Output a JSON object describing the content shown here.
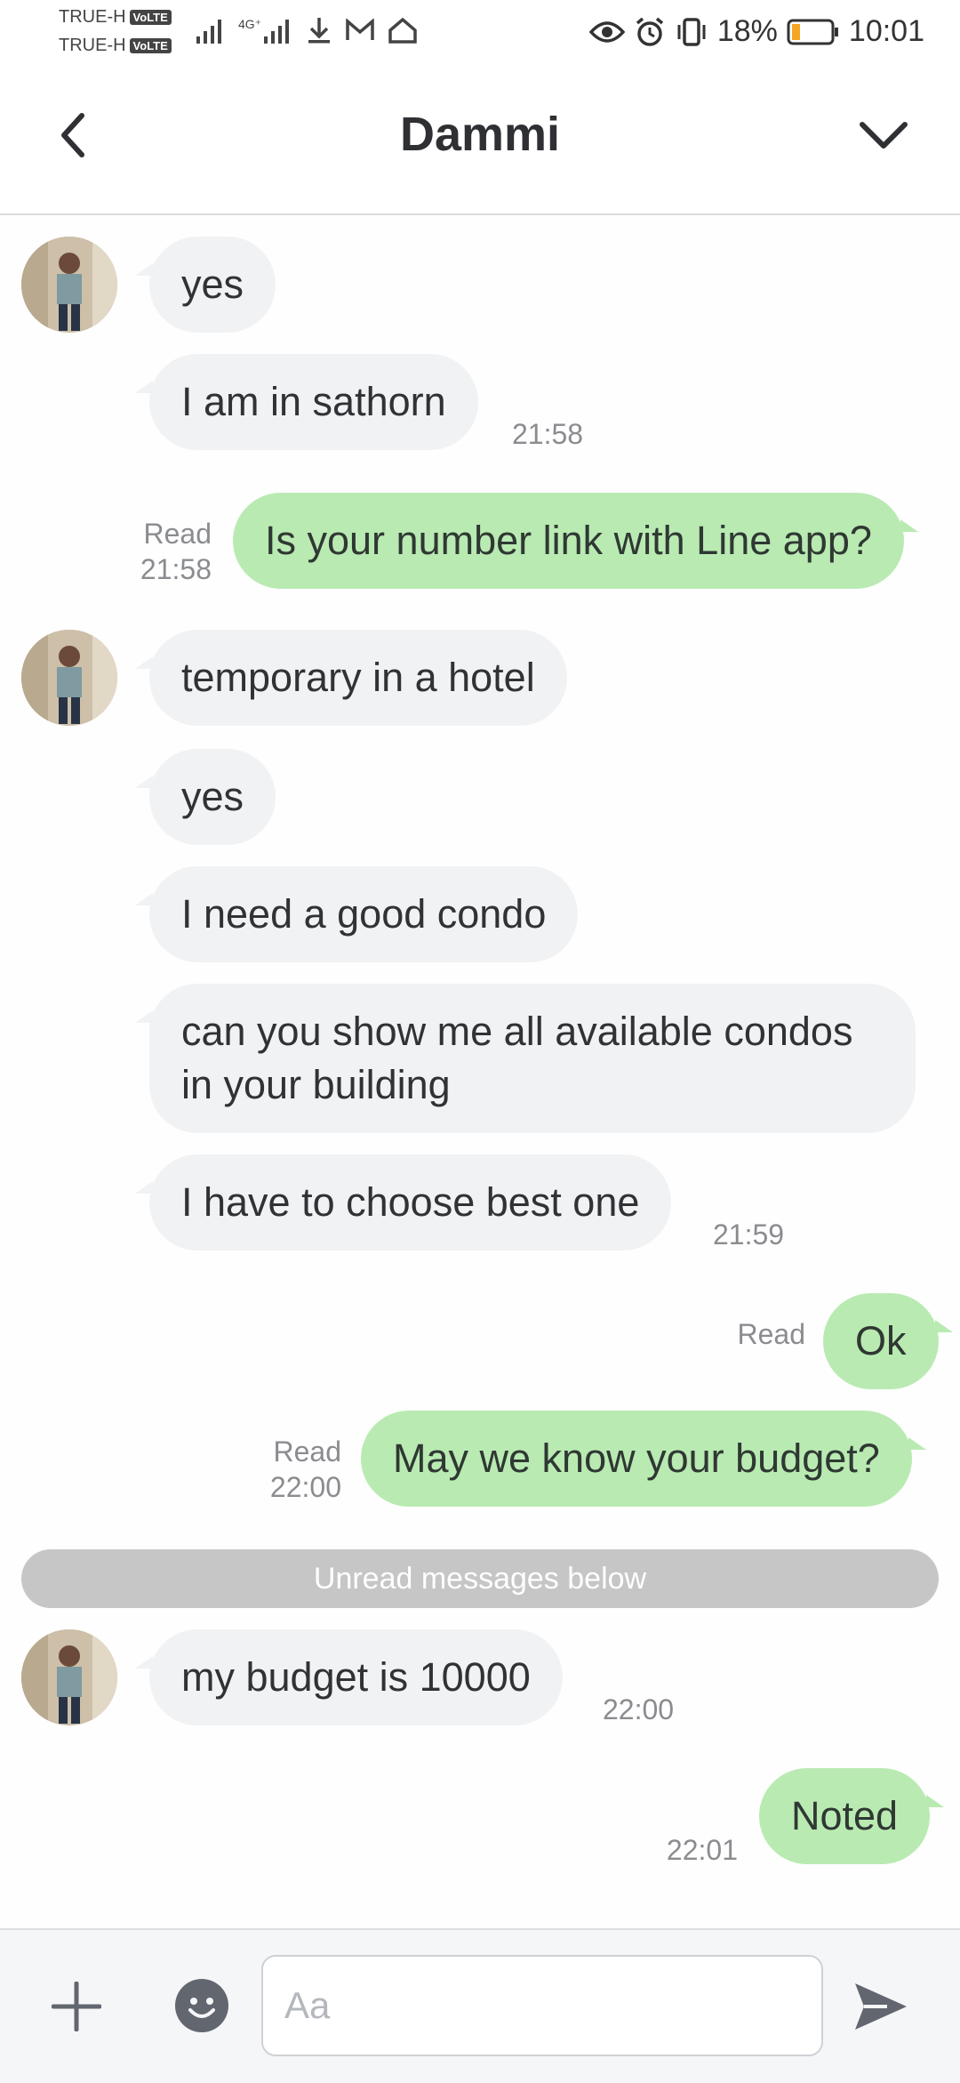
{
  "status_bar": {
    "carrier_1": "TRUE-H",
    "carrier_2": "TRUE-H",
    "volte_label": "VoLTE",
    "network_label": "4G⁺",
    "battery_percent": "18%",
    "time": "10:01"
  },
  "header": {
    "title": "Dammi"
  },
  "messages": [
    {
      "text": "yes"
    },
    {
      "text": "I am in sathorn",
      "time": "21:58"
    },
    {
      "text": "Is your number link with Line app?",
      "read": "Read",
      "time": "21:58"
    },
    {
      "text": "temporary in a hotel"
    },
    {
      "text": "yes"
    },
    {
      "text": "I need a good condo"
    },
    {
      "text": "can you show me all available condos in your building"
    },
    {
      "text": "I have to choose best one",
      "time": "21:59"
    },
    {
      "text": "Ok",
      "read": "Read"
    },
    {
      "text": "May we know your budget?",
      "read": "Read",
      "time": "22:00"
    },
    {
      "text": "my budget is 10000",
      "time": "22:00"
    },
    {
      "text": "Noted",
      "time": "22:01"
    }
  ],
  "divider": {
    "label": "Unread messages below"
  },
  "composer": {
    "placeholder": "Aa"
  },
  "colors": {
    "outgoing_bubble": "#b9eab2",
    "incoming_bubble": "#f1f2f4",
    "battery_low": "#f5a623"
  }
}
